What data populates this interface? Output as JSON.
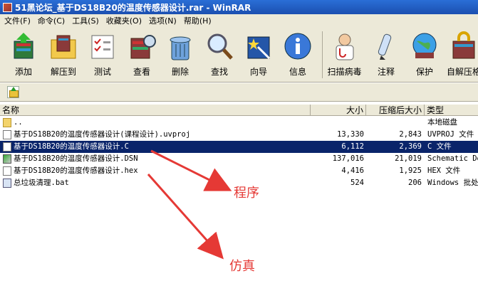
{
  "title": "51黑论坛_基于DS18B20的温度传感器设计.rar - WinRAR",
  "menu": [
    "文件(F)",
    "命令(C)",
    "工具(S)",
    "收藏夹(O)",
    "选项(N)",
    "帮助(H)"
  ],
  "toolbar": [
    {
      "label": "添加",
      "icon": "add-books-icon"
    },
    {
      "label": "解压到",
      "icon": "extract-folder-icon"
    },
    {
      "label": "测试",
      "icon": "test-checklist-icon"
    },
    {
      "label": "查看",
      "icon": "view-books-icon"
    },
    {
      "label": "删除",
      "icon": "delete-trash-icon"
    },
    {
      "label": "查找",
      "icon": "find-magnifier-icon"
    },
    {
      "label": "向导",
      "icon": "wizard-wand-icon"
    },
    {
      "label": "信息",
      "icon": "info-icon"
    },
    {
      "label": "扫描病毒",
      "icon": "scan-virus-doctor-icon"
    },
    {
      "label": "注释",
      "icon": "comment-pen-icon"
    },
    {
      "label": "保护",
      "icon": "protect-globe-icon"
    },
    {
      "label": "自解压格",
      "icon": "sfx-lock-icon"
    }
  ],
  "columns": {
    "name": "名称",
    "size": "大小",
    "packed": "压缩后大小",
    "type": "类型"
  },
  "files": [
    {
      "name": "..",
      "size": "",
      "packed": "",
      "type": "本地磁盘",
      "icon": "folder-icon",
      "selected": false
    },
    {
      "name": "基于DS18B20的温度传感器设计(课程设计).uvproj",
      "size": "13,330",
      "packed": "2,843",
      "type": "UVPROJ 文件",
      "icon": "document-icon",
      "selected": false
    },
    {
      "name": "基于DS18B20的温度传感器设计.C",
      "size": "6,112",
      "packed": "2,369",
      "type": "C 文件",
      "icon": "document-icon",
      "selected": true
    },
    {
      "name": "基于DS18B20的温度传感器设计.DSN",
      "size": "137,016",
      "packed": "21,019",
      "type": "Schematic De",
      "icon": "schematic-icon",
      "selected": false
    },
    {
      "name": "基于DS18B20的温度传感器设计.hex",
      "size": "4,416",
      "packed": "1,925",
      "type": "HEX 文件",
      "icon": "document-icon",
      "selected": false
    },
    {
      "name": "总垃圾清理.bat",
      "size": "524",
      "packed": "206",
      "type": "Windows 批处",
      "icon": "batch-file-icon",
      "selected": false
    }
  ],
  "annotations": {
    "program": "程序",
    "simulation": "仿真"
  }
}
